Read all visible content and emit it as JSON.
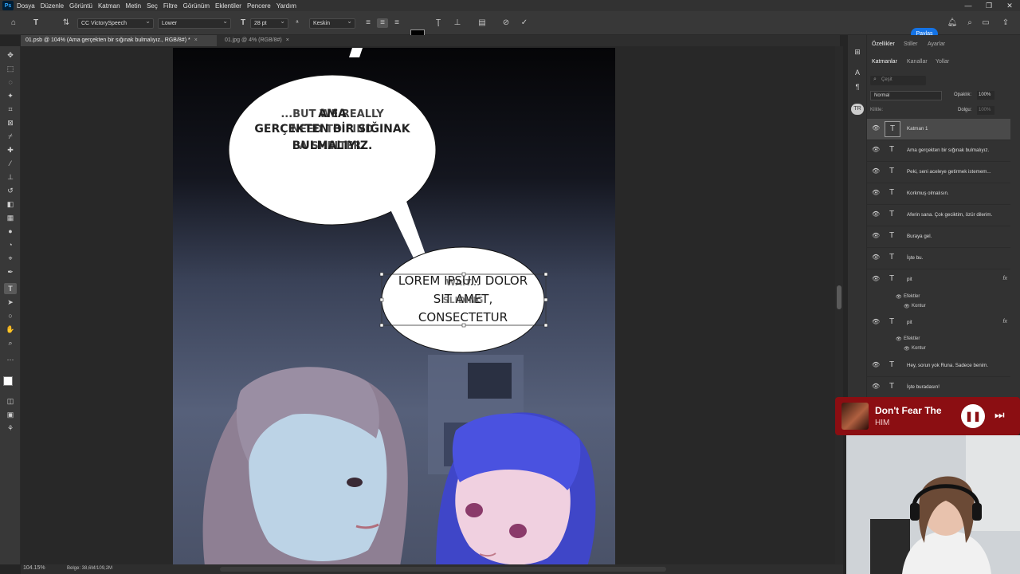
{
  "app": {
    "logo": "Ps"
  },
  "menu": [
    "Dosya",
    "Düzenle",
    "Görüntü",
    "Katman",
    "Metin",
    "Seç",
    "Filtre",
    "Görünüm",
    "Eklentiler",
    "Pencere",
    "Yardım"
  ],
  "options": {
    "font_family": "CC VictorySpeech",
    "font_style": "Lower",
    "font_size": "28 pt",
    "antialias": "Keskin",
    "text_color": "#000000",
    "share_label": "Paylaş"
  },
  "tabs": [
    {
      "label": "01.psb @ 104% (Ama gerçekten bir sığınak bulmalıyız., RGB/8#) *",
      "active": true
    },
    {
      "label": "01.jpg @ 4% (RGB/8#)",
      "active": false
    }
  ],
  "canvas": {
    "bubble1": {
      "en_line1": "...BUT WE REALLY",
      "en_line2": "NEED TO FIND",
      "en_line3": "A SHELTER.",
      "tr_line1": "AMA",
      "tr_line2": "GERÇEKTEN BİR SIĞINAK",
      "tr_line3": "BULMALIYIZ."
    },
    "bubble2": {
      "placeholder_line1": "LOREM IPSUM DOLOR",
      "placeholder_line2": "SIT AMET,",
      "placeholder_line3": "CONSECTETUR",
      "orig_line1": "WAIT...",
      "orig_line2": "SLIDING"
    }
  },
  "status": {
    "zoom": "104.15%",
    "doc": "Belge: 38,6M/109,2M"
  },
  "right_panel": {
    "tabs_top": [
      "Özellikler",
      "Stiller",
      "Ayarlar"
    ],
    "tabs": [
      "Katmanlar",
      "Kanallar",
      "Yollar"
    ],
    "search_placeholder": "Çeşit",
    "blend_mode": "Normal",
    "opacity_label": "Opaklık:",
    "opacity_value": "100%",
    "lock_label": "Kilitle:",
    "fill_label": "Dolgu:",
    "fill_value": "100%",
    "layers": [
      {
        "name": "Katman 1",
        "selected": true,
        "fx": false
      },
      {
        "name": "Ama gerçekten bir sığınak bulmalıyız.",
        "selected": false,
        "fx": false
      },
      {
        "name": "Peki, seni aceleye getirmek istemem...",
        "selected": false,
        "fx": false
      },
      {
        "name": "Korkmuş olmalısın.",
        "selected": false,
        "fx": false
      },
      {
        "name": "Aferin sana. Çok geciktim, özür dilerim.",
        "selected": false,
        "fx": false
      },
      {
        "name": "Buraya gel.",
        "selected": false,
        "fx": false
      },
      {
        "name": "İşte bu.",
        "selected": false,
        "fx": false
      },
      {
        "name": "pit",
        "selected": false,
        "fx": true
      },
      {
        "name": "pit",
        "selected": false,
        "fx": true
      },
      {
        "name": "Hey, sorun yok Runa. Sadece benim.",
        "selected": false,
        "fx": false
      },
      {
        "name": "İşte buradasın!",
        "selected": false,
        "fx": false
      }
    ],
    "effects_label": "Efektler",
    "stroke_label": "Kontur",
    "fx_label": "fx"
  },
  "music": {
    "title": "Don't Fear The",
    "artist": "HIM"
  }
}
